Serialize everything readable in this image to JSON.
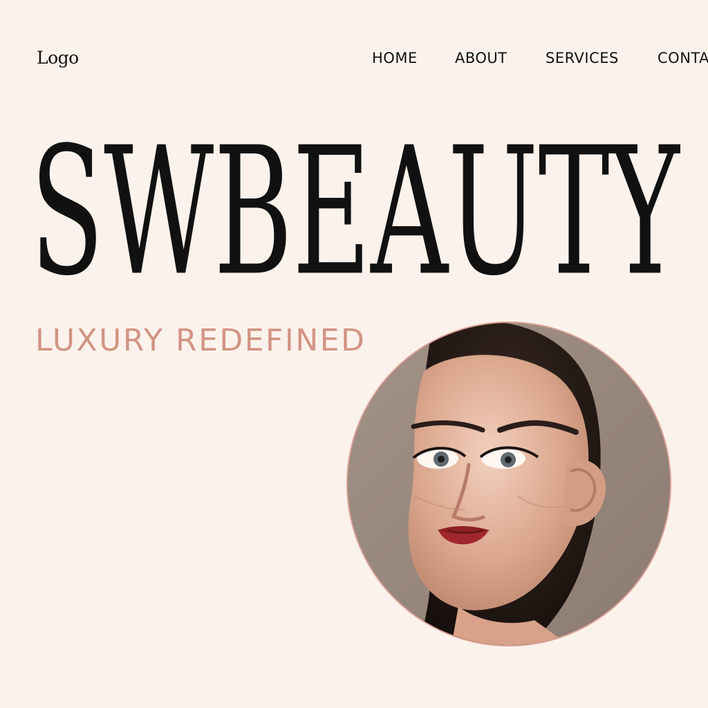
{
  "header": {
    "logo": "Logo",
    "nav": [
      {
        "label": "HOME"
      },
      {
        "label": "ABOUT"
      },
      {
        "label": "SERVICES"
      },
      {
        "label": "CONTACT"
      }
    ]
  },
  "hero": {
    "brand": "SWBEAUTY",
    "tagline": "LUXURY REDEFINED",
    "portrait": {
      "icon": "portrait-photo",
      "description_visible": "woman-with-red-lipstick"
    }
  },
  "colors": {
    "background": "#fbf2ec",
    "text": "#111111",
    "accent": "#d29484",
    "portrait_ring": "#dba295",
    "portrait_bg": "#9b8b82",
    "lip": "#8d1f24"
  }
}
